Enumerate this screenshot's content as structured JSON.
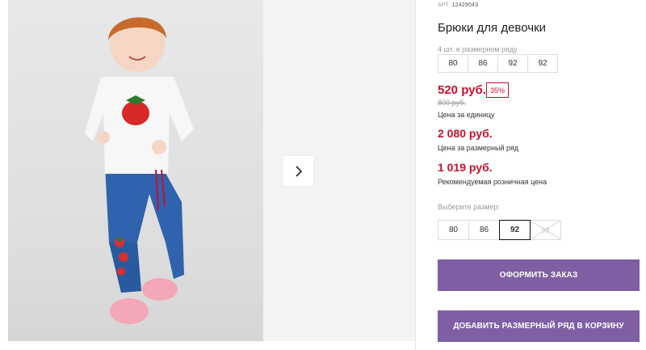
{
  "gallery": {
    "main_alt": "Девочка в белой футболке с клубникой и синих брюках",
    "next_icon": "chevron-right-icon"
  },
  "product": {
    "article_label": "АРТ.",
    "article_value": "12429043",
    "title": "Брюки для девочки",
    "size_row_label": "4 шт. в размерном ряду",
    "size_row": [
      "80",
      "86",
      "92",
      "92"
    ]
  },
  "prices": {
    "unit_price": "520 руб.",
    "discount": "35%",
    "old_price": "800 руб.",
    "unit_note": "Цена за единицу",
    "row_price": "2 080 руб.",
    "row_note": "Цена за размерный ряд",
    "retail_price": "1 019 руб.",
    "retail_note": "Рекомендуемая розничная цена"
  },
  "size_select": {
    "label": "Выберите размер:",
    "options": [
      "80",
      "86",
      "92",
      "98"
    ],
    "selected": "92"
  },
  "actions": {
    "order_label": "ОФОРМИТЬ ЗАКАЗ",
    "cart_label": "ДОБАВИТЬ РАЗМЕРНЫЙ РЯД В КОРЗИНУ"
  },
  "colors": {
    "accent": "#7e5fa3",
    "price_red": "#c8102e"
  }
}
